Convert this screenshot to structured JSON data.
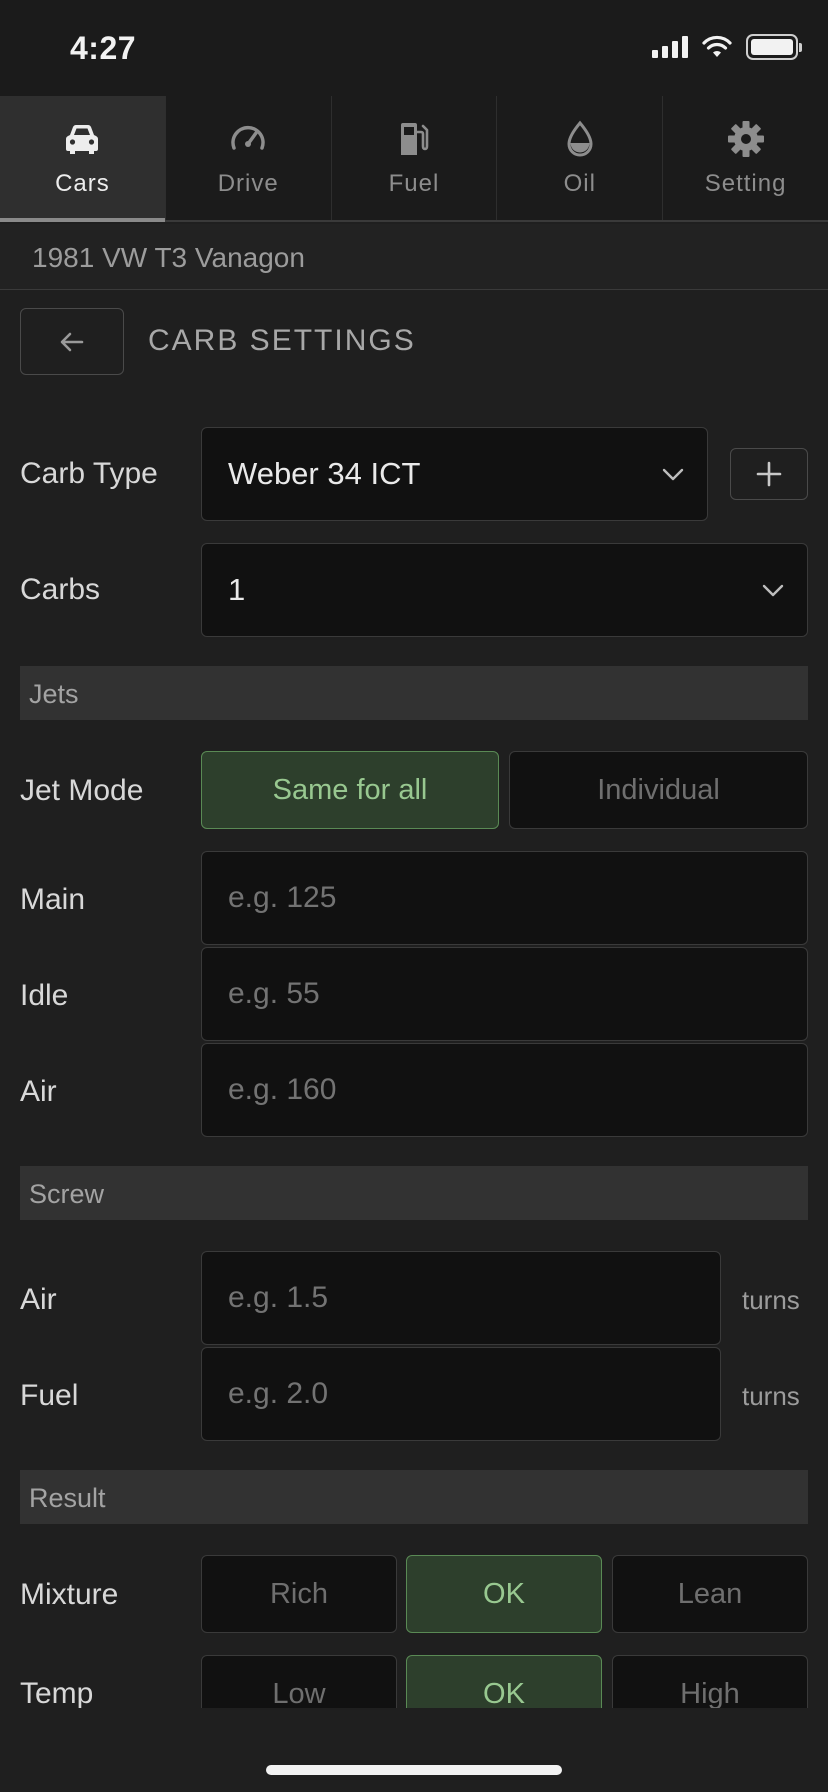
{
  "status": {
    "time": "4:27"
  },
  "tabs": [
    {
      "label": "Cars",
      "icon": "car-icon",
      "active": true
    },
    {
      "label": "Drive",
      "icon": "speedometer-icon",
      "active": false
    },
    {
      "label": "Fuel",
      "icon": "fuel-pump-icon",
      "active": false
    },
    {
      "label": "Oil",
      "icon": "oil-drop-icon",
      "active": false
    },
    {
      "label": "Setting",
      "icon": "gear-icon",
      "active": false
    }
  ],
  "vehicle": {
    "name": "1981 VW T3 Vanagon"
  },
  "header": {
    "title": "CARB SETTINGS",
    "back_icon": "arrow-left-icon"
  },
  "carb_type": {
    "label": "Carb Type",
    "value": "Weber 34 ICT"
  },
  "carbs": {
    "label": "Carbs",
    "value": "1"
  },
  "jets": {
    "section": "Jets",
    "mode_label": "Jet Mode",
    "mode_options": [
      "Same for all",
      "Individual"
    ],
    "mode_selected": "Same for all",
    "main": {
      "label": "Main",
      "placeholder": "e.g. 125"
    },
    "idle": {
      "label": "Idle",
      "placeholder": "e.g. 55"
    },
    "air": {
      "label": "Air",
      "placeholder": "e.g. 160"
    }
  },
  "screw": {
    "section": "Screw",
    "air": {
      "label": "Air",
      "placeholder": "e.g. 1.5",
      "unit": "turns"
    },
    "fuel": {
      "label": "Fuel",
      "placeholder": "e.g. 2.0",
      "unit": "turns"
    }
  },
  "result": {
    "section": "Result",
    "mixture": {
      "label": "Mixture",
      "options": [
        "Rich",
        "OK",
        "Lean"
      ],
      "selected": "OK"
    },
    "temp": {
      "label": "Temp",
      "options": [
        "Low",
        "OK",
        "High"
      ],
      "selected": "OK"
    }
  },
  "colors": {
    "accent_green_bg": "#2d3f2c",
    "accent_green_text": "#98c890",
    "background": "#1f1f1f"
  }
}
